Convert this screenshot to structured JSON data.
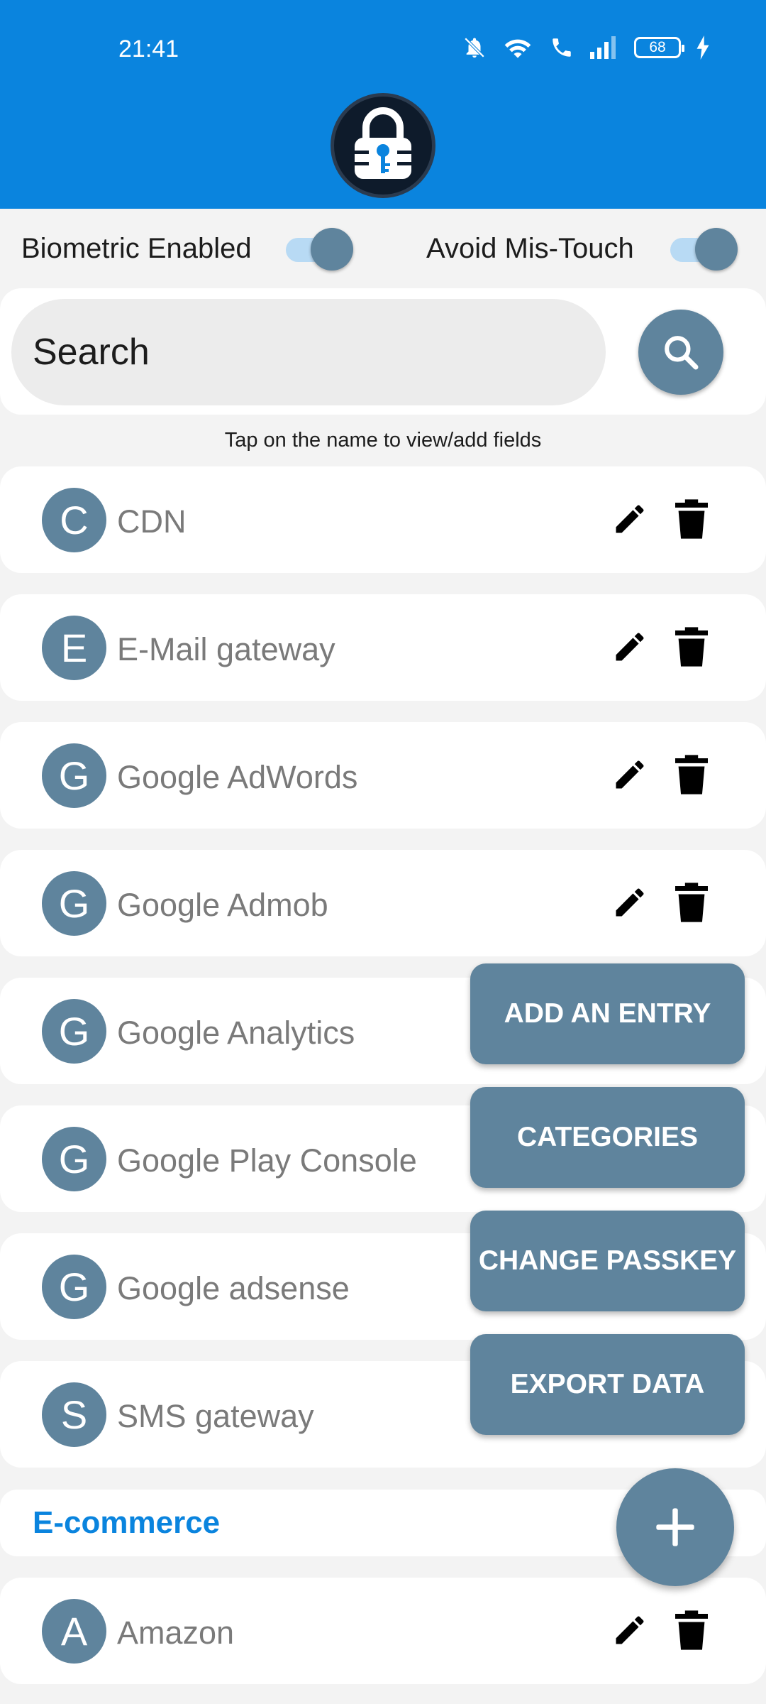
{
  "status_bar": {
    "time": "21:41",
    "battery": "68"
  },
  "settings": {
    "biometric_label": "Biometric Enabled",
    "mistouch_label": "Avoid Mis-Touch",
    "biometric_on": true,
    "mistouch_on": true
  },
  "search": {
    "placeholder": "Search"
  },
  "hint": "Tap on the name to view/add fields",
  "entries": [
    {
      "initial": "C",
      "name": "CDN"
    },
    {
      "initial": "E",
      "name": "E-Mail gateway"
    },
    {
      "initial": "G",
      "name": "Google AdWords"
    },
    {
      "initial": "G",
      "name": "Google Admob"
    },
    {
      "initial": "G",
      "name": "Google Analytics"
    },
    {
      "initial": "G",
      "name": "Google Play Console"
    },
    {
      "initial": "G",
      "name": "Google adsense"
    },
    {
      "initial": "S",
      "name": "SMS gateway"
    }
  ],
  "category": {
    "label": "E-commerce"
  },
  "category_entries": [
    {
      "initial": "A",
      "name": "Amazon"
    }
  ],
  "menu": {
    "add_entry": "ADD AN ENTRY",
    "categories": "CATEGORIES",
    "change_passkey": "CHANGE PASSKEY",
    "export_data": "EXPORT DATA"
  },
  "colors": {
    "primary": "#0a84de",
    "accent": "#5f849d"
  },
  "icons": {
    "search": "search-icon",
    "edit": "pencil-icon",
    "delete": "trash-icon",
    "add": "plus-icon"
  }
}
